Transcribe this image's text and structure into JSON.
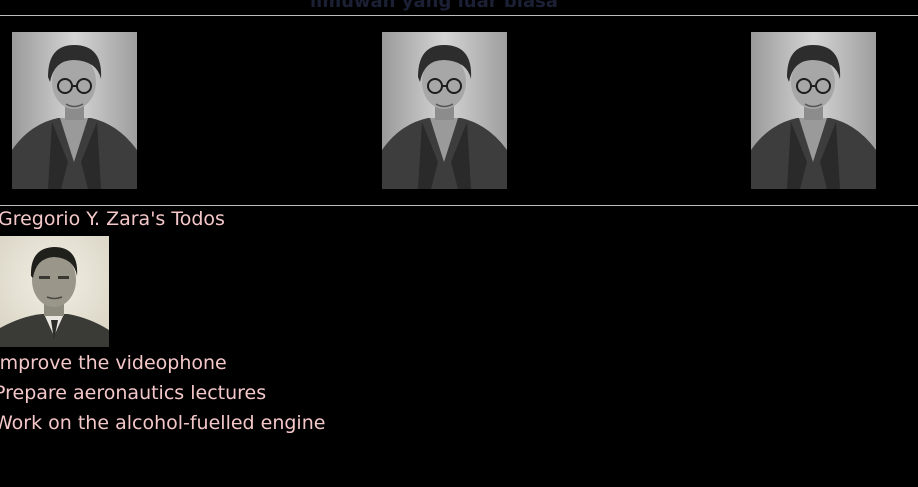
{
  "header": {
    "title": "ilmuwan yang luar biasa"
  },
  "gallery": {
    "images": [
      {
        "name": "portrait-photo-1"
      },
      {
        "name": "portrait-photo-2"
      },
      {
        "name": "portrait-photo-3"
      }
    ]
  },
  "profile": {
    "title": "Gregorio Y. Zara's Todos",
    "todos": [
      "Improve the videophone",
      "Prepare aeronautics lectures",
      "Work on the alcohol-fuelled engine"
    ]
  },
  "colors": {
    "background": "#000000",
    "text_pink": "#f4c7c9",
    "title_dark": "#1b2034",
    "rule": "#bdbdbd"
  }
}
